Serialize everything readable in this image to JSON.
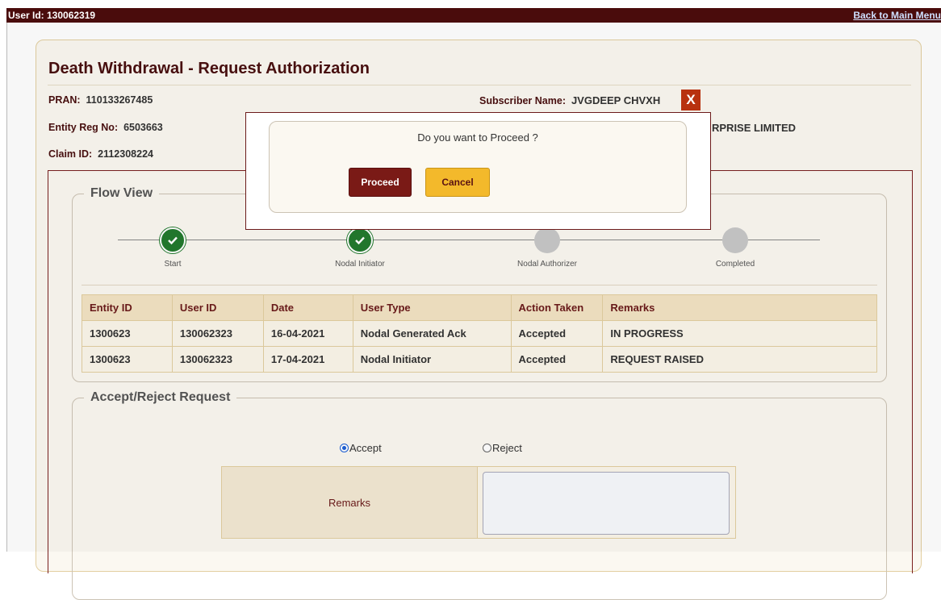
{
  "topbar": {
    "user_id": "User Id: 130062319",
    "back_link": "Back to Main Menu"
  },
  "page": {
    "title": "Death Withdrawal - Request Authorization",
    "pran_label": "PRAN:",
    "pran_value": "110133267485",
    "subscriber_label": "Subscriber Name:",
    "subscriber_value": "JVGDEEP CHVXH",
    "entity_label": "Entity Reg No:",
    "entity_value": "6503663",
    "entity_name_partial": "RPRISE LIMITED",
    "claim_label": "Claim ID:",
    "claim_value": "2112308224"
  },
  "flow_view": {
    "legend": "Flow View",
    "steps": [
      {
        "label": "Start",
        "status": "done"
      },
      {
        "label": "Nodal Initiator",
        "status": "done"
      },
      {
        "label": "Nodal Authorizer",
        "status": "pending"
      },
      {
        "label": "Completed",
        "status": "pending"
      }
    ],
    "table": {
      "headers": [
        "Entity ID",
        "User ID",
        "Date",
        "User Type",
        "Action Taken",
        "Remarks"
      ],
      "rows": [
        [
          "1300623",
          "130062323",
          "16-04-2021",
          "Nodal Generated Ack",
          "Accepted",
          "IN PROGRESS"
        ],
        [
          "1300623",
          "130062323",
          "17-04-2021",
          "Nodal Initiator",
          "Accepted",
          "REQUEST RAISED"
        ]
      ]
    }
  },
  "accept_reject": {
    "legend": "Accept/Reject Request",
    "accept_label": "Accept",
    "reject_label": "Reject",
    "selected": "Accept",
    "remarks_label": "Remarks",
    "remarks_value": ""
  },
  "modal": {
    "message": "Do you want to Proceed ?",
    "proceed_label": "Proceed",
    "cancel_label": "Cancel",
    "close_label": "X"
  },
  "colors": {
    "brand_dark": "#4a0c0c",
    "title": "#4a1010",
    "success": "#237a2e",
    "pending": "#c8c8c8",
    "proceed_button": "#7a1a16",
    "cancel_button": "#f3b92b",
    "close_button": "#b8310f"
  }
}
